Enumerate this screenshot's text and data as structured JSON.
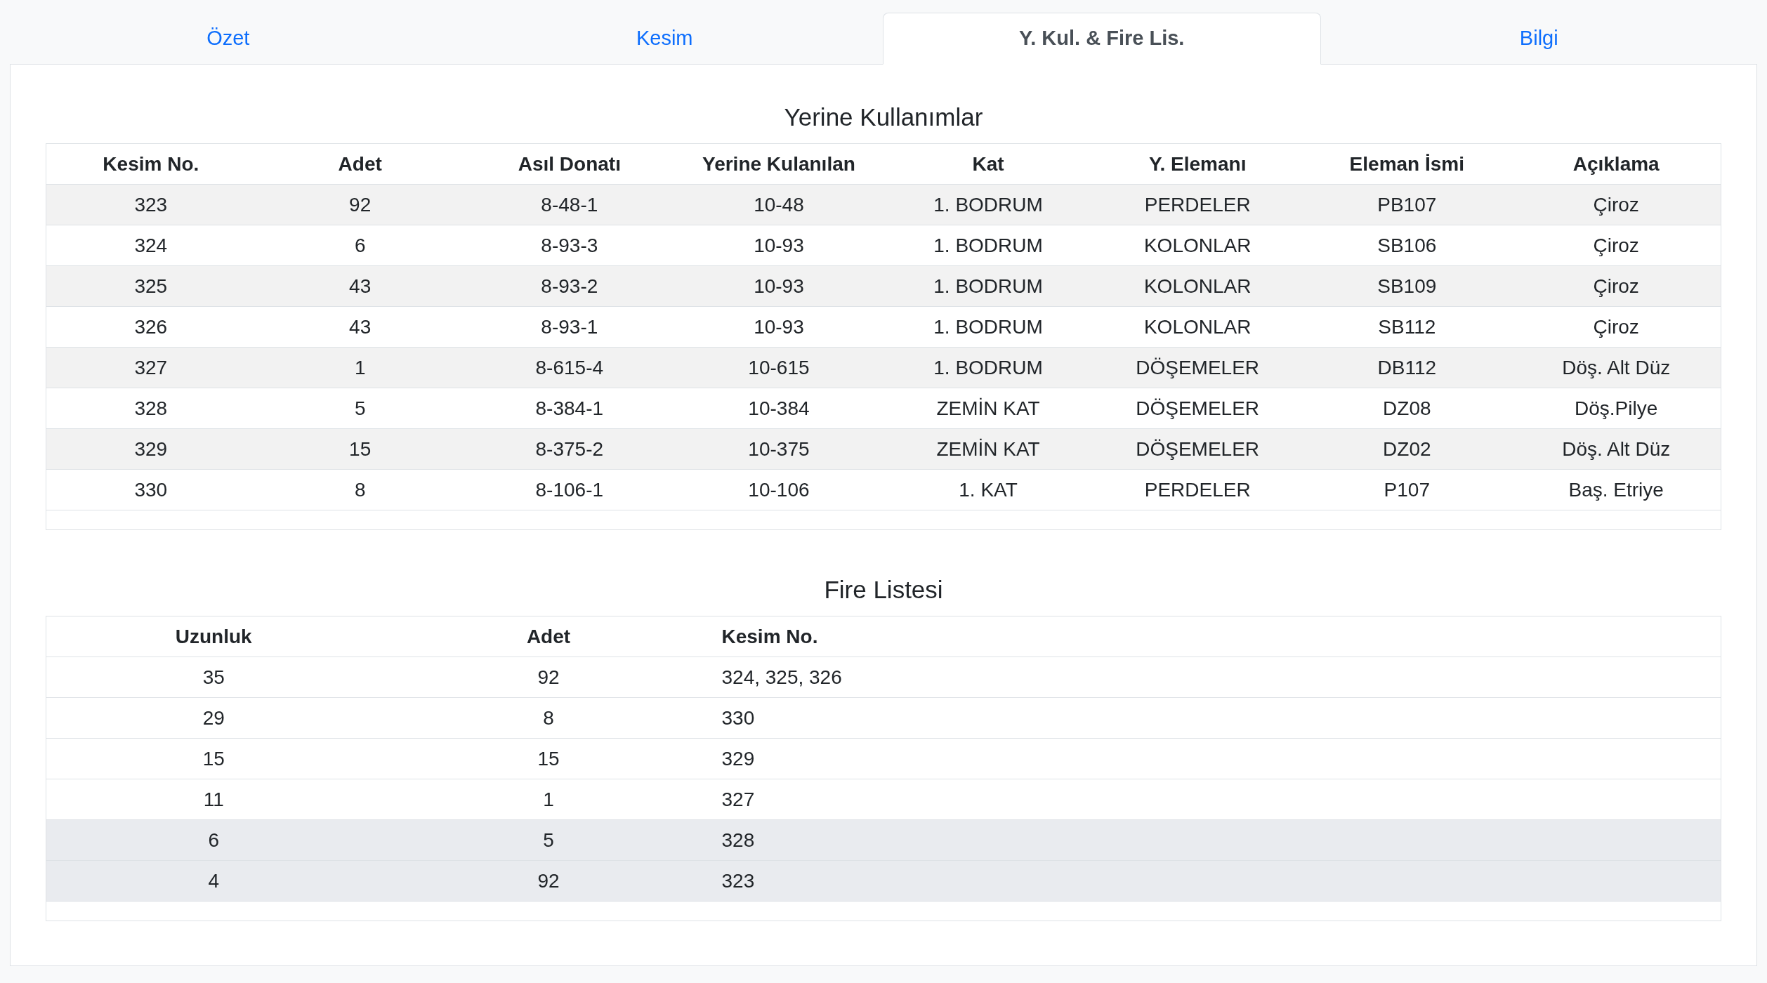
{
  "tabs": [
    {
      "label": "Özet",
      "selected": false
    },
    {
      "label": "Kesim",
      "selected": false
    },
    {
      "label": "Y. Kul. & Fire Lis.",
      "selected": true
    },
    {
      "label": "Bilgi",
      "selected": false
    }
  ],
  "substitutions": {
    "title": "Yerine Kullanımlar",
    "columns": [
      "Kesim No.",
      "Adet",
      "Asıl Donatı",
      "Yerine Kulanılan",
      "Kat",
      "Y. Elemanı",
      "Eleman İsmi",
      "Açıklama"
    ],
    "rows": [
      [
        "323",
        "92",
        "8-48-1",
        "10-48",
        "1. BODRUM",
        "PERDELER",
        "PB107",
        "Çiroz"
      ],
      [
        "324",
        "6",
        "8-93-3",
        "10-93",
        "1. BODRUM",
        "KOLONLAR",
        "SB106",
        "Çiroz"
      ],
      [
        "325",
        "43",
        "8-93-2",
        "10-93",
        "1. BODRUM",
        "KOLONLAR",
        "SB109",
        "Çiroz"
      ],
      [
        "326",
        "43",
        "8-93-1",
        "10-93",
        "1. BODRUM",
        "KOLONLAR",
        "SB112",
        "Çiroz"
      ],
      [
        "327",
        "1",
        "8-615-4",
        "10-615",
        "1. BODRUM",
        "DÖŞEMELER",
        "DB112",
        "Döş. Alt Düz"
      ],
      [
        "328",
        "5",
        "8-384-1",
        "10-384",
        "ZEMİN KAT",
        "DÖŞEMELER",
        "DZ08",
        "Döş.Pilye"
      ],
      [
        "329",
        "15",
        "8-375-2",
        "10-375",
        "ZEMİN KAT",
        "DÖŞEMELER",
        "DZ02",
        "Döş. Alt Düz"
      ],
      [
        "330",
        "8",
        "8-106-1",
        "10-106",
        "1. KAT",
        "PERDELER",
        "P107",
        "Baş. Etriye"
      ]
    ]
  },
  "waste": {
    "title": "Fire Listesi",
    "columns": [
      "Uzunluk",
      "Adet",
      "Kesim No."
    ],
    "rows": [
      {
        "cells": [
          "35",
          "92",
          "324, 325, 326"
        ],
        "selected": false
      },
      {
        "cells": [
          "29",
          "8",
          "330"
        ],
        "selected": false
      },
      {
        "cells": [
          "15",
          "15",
          "329"
        ],
        "selected": false
      },
      {
        "cells": [
          "11",
          "1",
          "327"
        ],
        "selected": false
      },
      {
        "cells": [
          "6",
          "5",
          "328"
        ],
        "selected": true
      },
      {
        "cells": [
          "4",
          "92",
          "323"
        ],
        "selected": true
      }
    ]
  }
}
